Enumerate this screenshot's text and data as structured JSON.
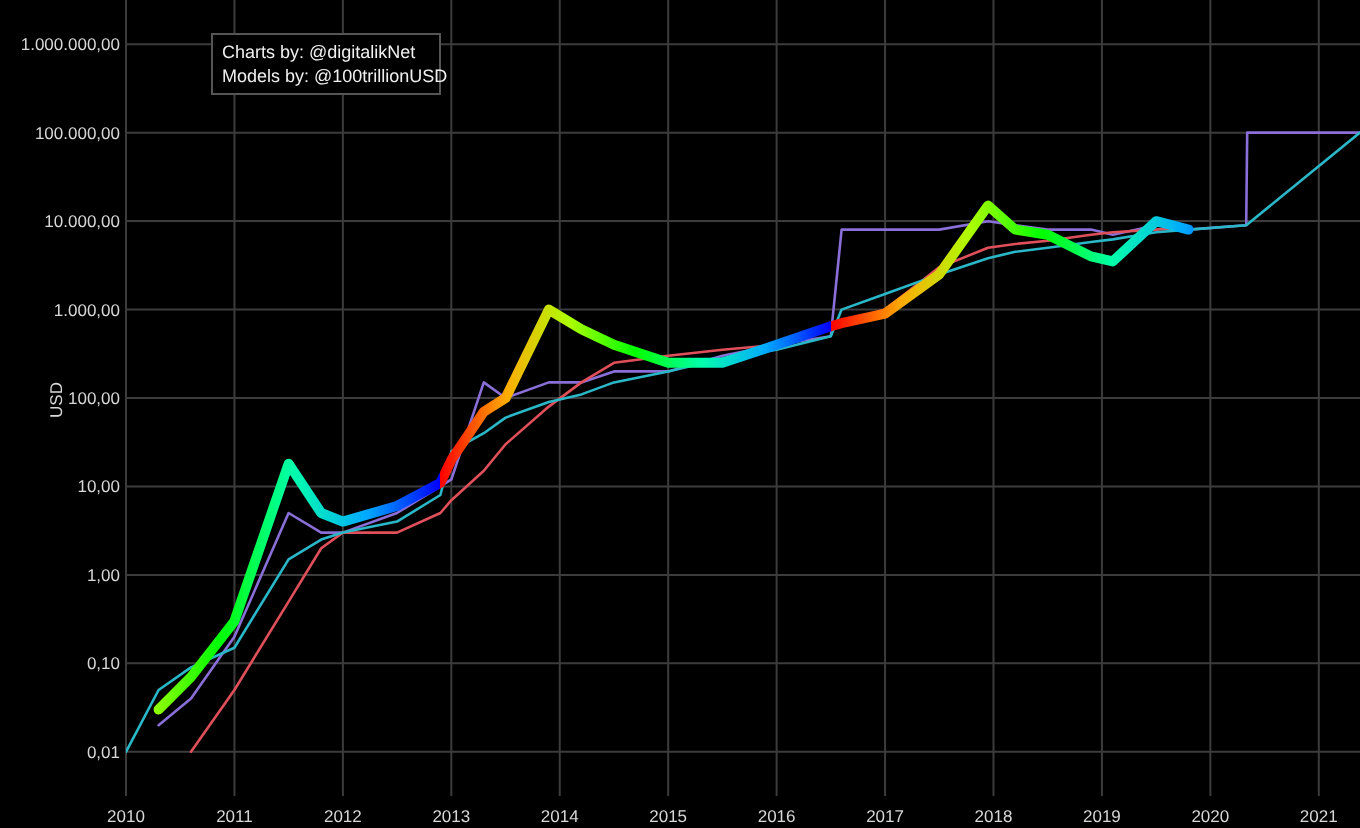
{
  "chart": {
    "y_axis_title": "USD",
    "y_axis_labels": [
      "1.000.000,00",
      "100.000,00",
      "10.000,00",
      "1.000,00",
      "100,00",
      "10,00",
      "1,00",
      "0,10",
      "0,01"
    ],
    "x_axis_labels": [
      "2010",
      "2011",
      "2012",
      "2013",
      "2014",
      "2015",
      "2016",
      "2017",
      "2018",
      "2019",
      "2020",
      "2021"
    ]
  },
  "credits": [
    "Charts by: @digitalikNet",
    "Models by: @100trillionUSD"
  ]
}
